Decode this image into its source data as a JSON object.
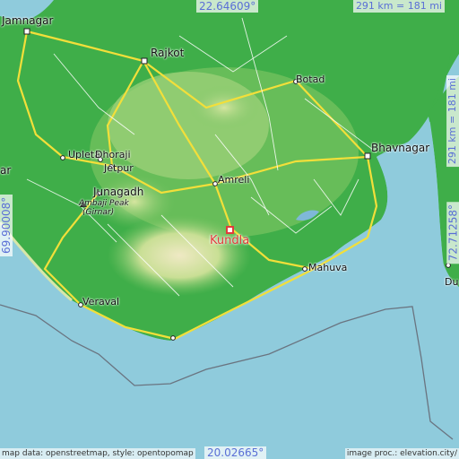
{
  "coords": {
    "lat_top": "22.64609°",
    "lat_bottom": "20.02665°",
    "lon_left": "69.90008°",
    "lon_right": "72.71258°"
  },
  "scale": {
    "top": "291 km = 181 mi",
    "right": "291 km = 181 mi"
  },
  "credits": {
    "left": "map data: openstreetmap, style: opentopomap",
    "right": "image proc.: elevation.city/"
  },
  "highlight_city": "Kundla",
  "cities": [
    {
      "key": "jamnagar",
      "name": "Jamnagar"
    },
    {
      "key": "rajkot",
      "name": "Rajkot"
    },
    {
      "key": "botad",
      "name": "Botad"
    },
    {
      "key": "bhavnagar",
      "name": "Bhavnagar"
    },
    {
      "key": "upleta",
      "name": "Upleta"
    },
    {
      "key": "dhoraji",
      "name": "Dhoraji"
    },
    {
      "key": "jetpur",
      "name": "Jetpur"
    },
    {
      "key": "junagadh",
      "name": "Junagadh"
    },
    {
      "key": "ambaji",
      "name": "Ambaji Peak"
    },
    {
      "key": "girnar",
      "name": "(Girnar)"
    },
    {
      "key": "amreli",
      "name": "Amreli"
    },
    {
      "key": "mahuva",
      "name": "Mahuva"
    },
    {
      "key": "veraval",
      "name": "Veraval"
    },
    {
      "key": "ar",
      "name": "ar"
    },
    {
      "key": "dur",
      "name": "Du"
    }
  ],
  "colors": {
    "sea": "#8fcbdc",
    "lowland": "#3fae49",
    "upland": "#a6d77a",
    "highland": "#e6e2b0",
    "road_major": "#f2df3a",
    "road_minor": "#ffffff",
    "highlight": "#e23b3b"
  }
}
